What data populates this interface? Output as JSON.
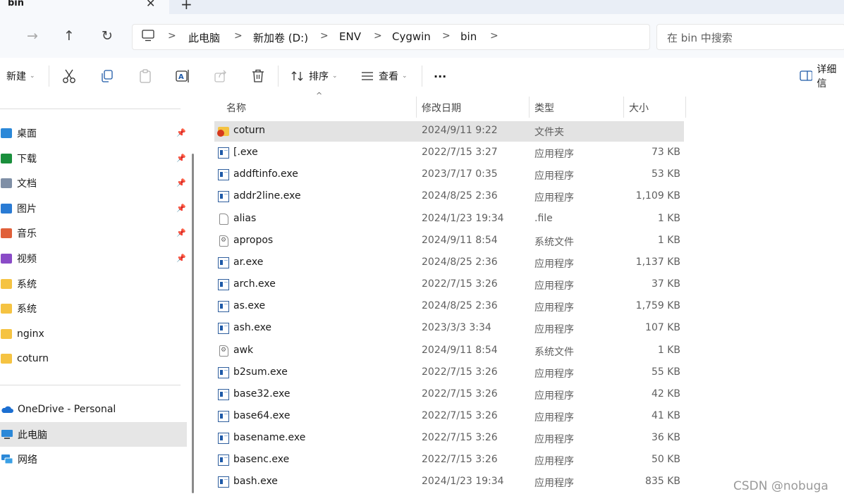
{
  "tab": {
    "title": "bin",
    "close": "✕",
    "new_tab": "+"
  },
  "nav": {
    "forward": "→",
    "up": "↑",
    "refresh": "↻"
  },
  "address": {
    "crumbs": [
      "此电脑",
      "新加卷 (D:)",
      "ENV",
      "Cygwin",
      "bin"
    ],
    "separator": ">"
  },
  "search": {
    "placeholder": "在 bin 中搜索"
  },
  "toolbar": {
    "new_label": "新建",
    "sort_label": "排序",
    "view_label": "查看",
    "more_label": "···",
    "details_label": "详细信",
    "caret": "⌄"
  },
  "sidebar": {
    "quick_access": [
      {
        "label": "桌面",
        "icon": "desktop-icon",
        "color": "#2b88d8",
        "pinned": true
      },
      {
        "label": "下载",
        "icon": "download-icon",
        "color": "#1a8f3c",
        "pinned": true
      },
      {
        "label": "文档",
        "icon": "document-icon",
        "color": "#7f8fa6",
        "pinned": true
      },
      {
        "label": "图片",
        "icon": "pictures-icon",
        "color": "#2a7bd4",
        "pinned": true
      },
      {
        "label": "音乐",
        "icon": "music-icon",
        "color": "#e0603a",
        "pinned": true
      },
      {
        "label": "视频",
        "icon": "videos-icon",
        "color": "#8a4bc7",
        "pinned": true
      },
      {
        "label": "系统",
        "icon": "folder-icon",
        "color": "#f5c342",
        "pinned": false
      },
      {
        "label": "系统",
        "icon": "folder-icon",
        "color": "#f5c342",
        "pinned": false
      },
      {
        "label": "nginx",
        "icon": "folder-icon",
        "color": "#f5c342",
        "pinned": false
      },
      {
        "label": "coturn",
        "icon": "folder-icon",
        "color": "#f5c342",
        "pinned": false
      }
    ],
    "onedrive": "OneDrive - Personal",
    "this_pc": "此电脑",
    "network": "网络",
    "pin_glyph": "📌"
  },
  "columns": {
    "name": "名称",
    "date": "修改日期",
    "type": "类型",
    "size": "大小",
    "sort_indicator": "^"
  },
  "files": [
    {
      "name": "coturn",
      "date": "2024/9/11 9:22",
      "type": "文件夹",
      "size": "",
      "kind": "folder"
    },
    {
      "name": "[.exe",
      "date": "2022/7/15 3:27",
      "type": "应用程序",
      "size": "73 KB",
      "kind": "exe"
    },
    {
      "name": "addftinfo.exe",
      "date": "2023/7/17 0:35",
      "type": "应用程序",
      "size": "53 KB",
      "kind": "exe"
    },
    {
      "name": "addr2line.exe",
      "date": "2024/8/25 2:36",
      "type": "应用程序",
      "size": "1,109 KB",
      "kind": "exe"
    },
    {
      "name": "alias",
      "date": "2024/1/23 19:34",
      "type": ".file",
      "size": "1 KB",
      "kind": "file"
    },
    {
      "name": "apropos",
      "date": "2024/9/11 8:54",
      "type": "系统文件",
      "size": "1 KB",
      "kind": "sys"
    },
    {
      "name": "ar.exe",
      "date": "2024/8/25 2:36",
      "type": "应用程序",
      "size": "1,137 KB",
      "kind": "exe"
    },
    {
      "name": "arch.exe",
      "date": "2022/7/15 3:26",
      "type": "应用程序",
      "size": "37 KB",
      "kind": "exe"
    },
    {
      "name": "as.exe",
      "date": "2024/8/25 2:36",
      "type": "应用程序",
      "size": "1,759 KB",
      "kind": "exe"
    },
    {
      "name": "ash.exe",
      "date": "2023/3/3 3:34",
      "type": "应用程序",
      "size": "107 KB",
      "kind": "exe"
    },
    {
      "name": "awk",
      "date": "2024/9/11 8:54",
      "type": "系统文件",
      "size": "1 KB",
      "kind": "sys"
    },
    {
      "name": "b2sum.exe",
      "date": "2022/7/15 3:26",
      "type": "应用程序",
      "size": "55 KB",
      "kind": "exe"
    },
    {
      "name": "base32.exe",
      "date": "2022/7/15 3:26",
      "type": "应用程序",
      "size": "42 KB",
      "kind": "exe"
    },
    {
      "name": "base64.exe",
      "date": "2022/7/15 3:26",
      "type": "应用程序",
      "size": "41 KB",
      "kind": "exe"
    },
    {
      "name": "basename.exe",
      "date": "2022/7/15 3:26",
      "type": "应用程序",
      "size": "36 KB",
      "kind": "exe"
    },
    {
      "name": "basenc.exe",
      "date": "2022/7/15 3:26",
      "type": "应用程序",
      "size": "50 KB",
      "kind": "exe"
    },
    {
      "name": "bash.exe",
      "date": "2024/1/23 19:34",
      "type": "应用程序",
      "size": "835 KB",
      "kind": "exe"
    }
  ],
  "watermark": "CSDN @nobuga"
}
